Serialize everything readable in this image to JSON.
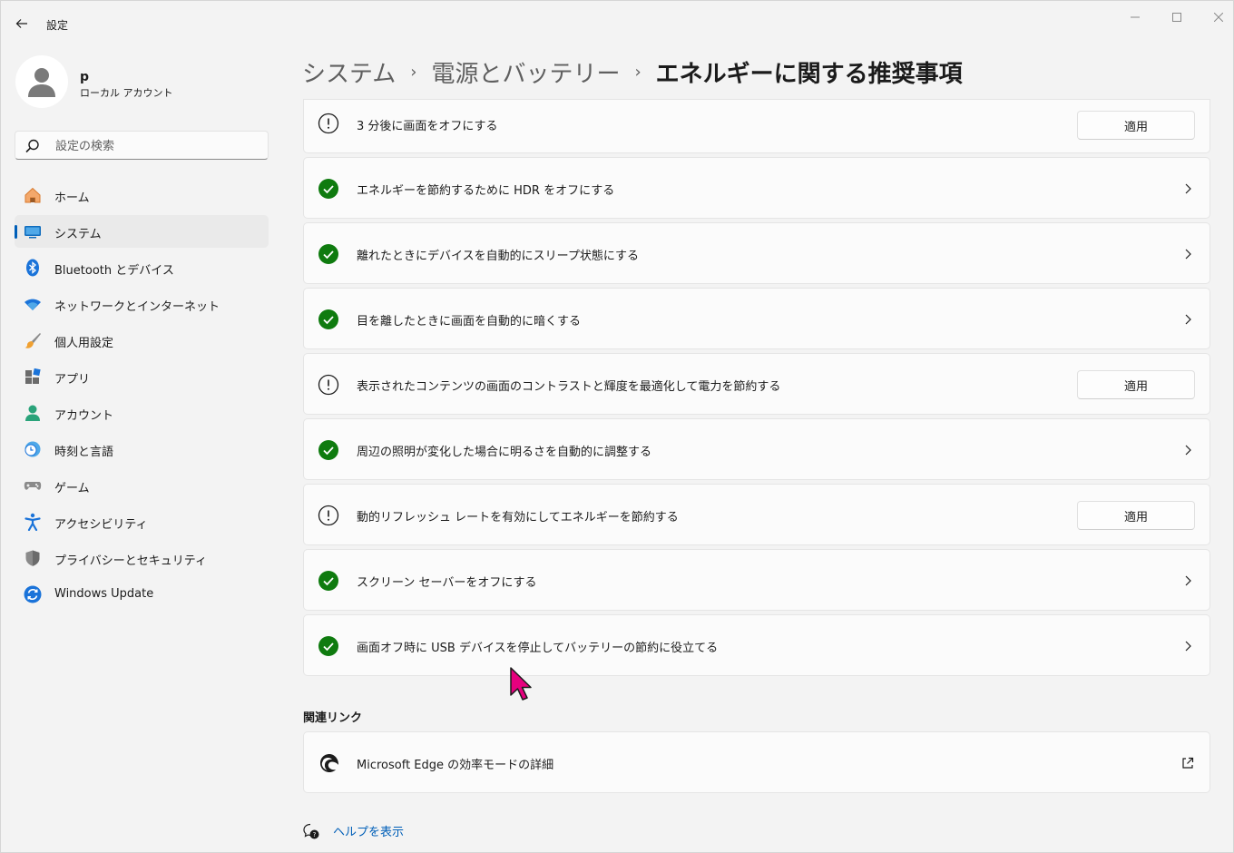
{
  "app": {
    "title": "設定"
  },
  "profile": {
    "name": "p",
    "account_type": "ローカル アカウント"
  },
  "search": {
    "placeholder": "設定の検索"
  },
  "sidebar": {
    "items": [
      {
        "label": "ホーム",
        "icon": "home-icon"
      },
      {
        "label": "システム",
        "icon": "system-icon",
        "active": true
      },
      {
        "label": "Bluetooth とデバイス",
        "icon": "bluetooth-icon"
      },
      {
        "label": "ネットワークとインターネット",
        "icon": "wifi-icon"
      },
      {
        "label": "個人用設定",
        "icon": "brush-icon"
      },
      {
        "label": "アプリ",
        "icon": "apps-icon"
      },
      {
        "label": "アカウント",
        "icon": "account-icon"
      },
      {
        "label": "時刻と言語",
        "icon": "time-language-icon"
      },
      {
        "label": "ゲーム",
        "icon": "gamepad-icon"
      },
      {
        "label": "アクセシビリティ",
        "icon": "accessibility-icon"
      },
      {
        "label": "プライバシーとセキュリティ",
        "icon": "shield-icon"
      },
      {
        "label": "Windows Update",
        "icon": "windows-update-icon"
      }
    ]
  },
  "breadcrumb": {
    "part1": "システム",
    "part2": "電源とバッテリー",
    "current": "エネルギーに関する推奨事項",
    "separator": "›"
  },
  "recommendations": [
    {
      "label": "3 分後に画面をオフにする",
      "status": "warning",
      "action": "適用"
    },
    {
      "label": "エネルギーを節約するために HDR をオフにする",
      "status": "ok"
    },
    {
      "label": "離れたときにデバイスを自動的にスリープ状態にする",
      "status": "ok"
    },
    {
      "label": "目を離したときに画面を自動的に暗くする",
      "status": "ok"
    },
    {
      "label": "表示されたコンテンツの画面のコントラストと輝度を最適化して電力を節約する",
      "status": "warning",
      "action": "適用"
    },
    {
      "label": "周辺の照明が変化した場合に明るさを自動的に調整する",
      "status": "ok"
    },
    {
      "label": "動的リフレッシュ レートを有効にしてエネルギーを節約する",
      "status": "warning",
      "action": "適用"
    },
    {
      "label": "スクリーン セーバーをオフにする",
      "status": "ok"
    },
    {
      "label": "画面オフ時に USB デバイスを停止してバッテリーの節約に役立てる",
      "status": "ok"
    }
  ],
  "related": {
    "title": "関連リンク",
    "link_label": "Microsoft Edge の効率モードの詳細"
  },
  "help": {
    "label": "ヘルプを表示"
  },
  "colors": {
    "accent": "#005fb8",
    "ok_green": "#0f7b0f",
    "cursor": "#e6007e"
  }
}
